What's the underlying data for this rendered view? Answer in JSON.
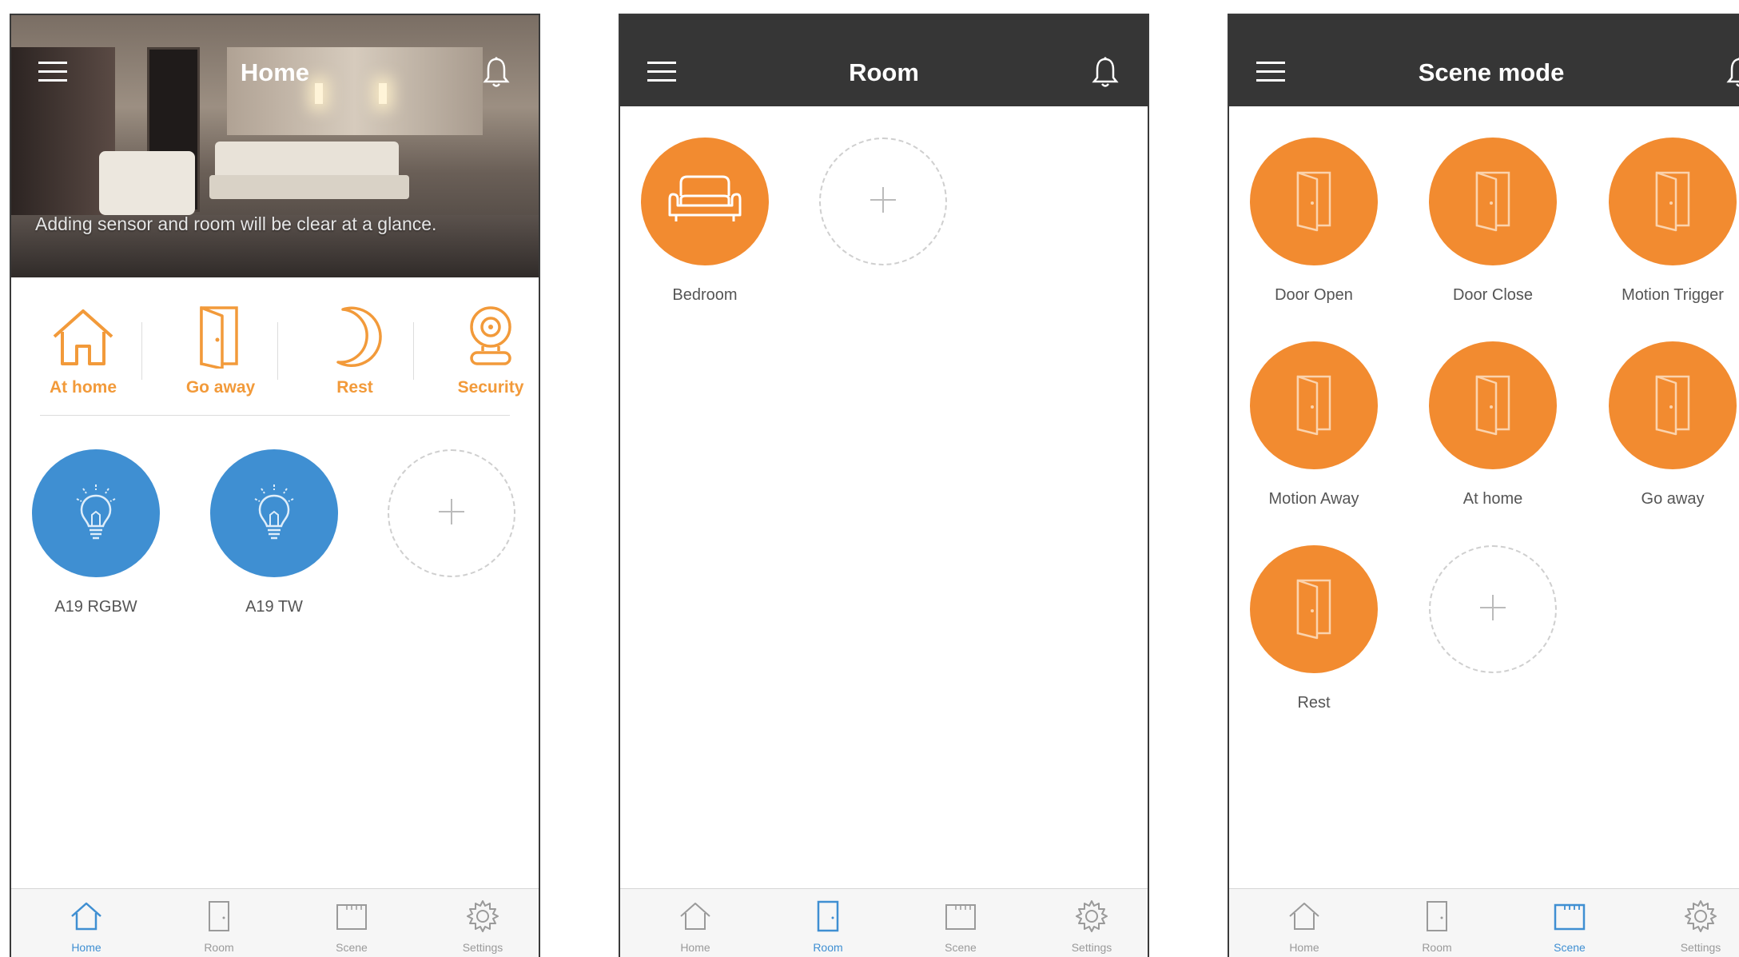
{
  "screens": {
    "home": {
      "title": "Home",
      "banner_text": "Adding sensor and room will be clear at a glance.",
      "modes": [
        {
          "label": "At home",
          "icon": "house-icon"
        },
        {
          "label": "Go away",
          "icon": "door-icon"
        },
        {
          "label": "Rest",
          "icon": "moon-icon"
        },
        {
          "label": "Security",
          "icon": "camera-icon"
        }
      ],
      "devices": [
        {
          "label": "A19 RGBW",
          "icon": "bulb-icon"
        },
        {
          "label": "A19 TW",
          "icon": "bulb-icon"
        }
      ]
    },
    "room": {
      "title": "Room",
      "rooms": [
        {
          "label": "Bedroom",
          "icon": "sofa-icon"
        }
      ]
    },
    "scene": {
      "title": "Scene mode",
      "scenes": [
        {
          "label": "Door Open"
        },
        {
          "label": "Door Close"
        },
        {
          "label": "Motion Trigger"
        },
        {
          "label": "Motion Away"
        },
        {
          "label": "At home"
        },
        {
          "label": "Go away"
        },
        {
          "label": "Rest"
        }
      ]
    }
  },
  "tabs": [
    {
      "label": "Home",
      "icon": "house-icon"
    },
    {
      "label": "Room",
      "icon": "door-icon"
    },
    {
      "label": "Scene",
      "icon": "scene-icon"
    },
    {
      "label": "Settings",
      "icon": "gear-icon"
    }
  ],
  "colors": {
    "accent_orange": "#f28b30",
    "accent_blue": "#3f8fd2",
    "header_dark": "#363636",
    "mode_label": "#f29a3a"
  }
}
